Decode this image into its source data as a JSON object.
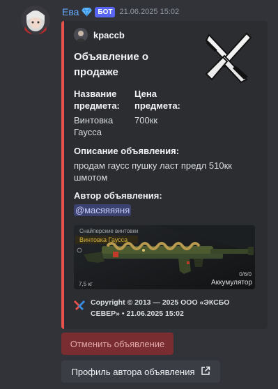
{
  "message": {
    "author": "Ева",
    "badge": "БОТ",
    "timestamp": "21.06.2025 15:02"
  },
  "embed": {
    "author_name": "kpaccb",
    "title": "Объявление о продаже",
    "accent_color": "#e8524a",
    "fields": [
      {
        "name": "Название предмета:",
        "value": "Винтовка Гаусса"
      },
      {
        "name": "Цена предмета:",
        "value": "700кк"
      },
      {
        "name": "Описание объявления:",
        "value": "продам гаусс пушку ласт предл 510кк шмотом"
      },
      {
        "name": "Автор объявления:",
        "value": "@масяяяяня"
      }
    ],
    "image": {
      "category": "Снайперские винтовки",
      "item_name": "Винтовка Гаусса",
      "weight": "7,5 кг",
      "ammo": "0/6/0",
      "ammo_type": "Аккумулятор"
    },
    "footer": "Copyright © 2013 — 2025 ООО «ЭКСБО СЕВЕР» • 21.06.2025 15:02"
  },
  "buttons": {
    "cancel_label": "Отменить объявление",
    "profile_label": "Профиль автора объявления"
  }
}
